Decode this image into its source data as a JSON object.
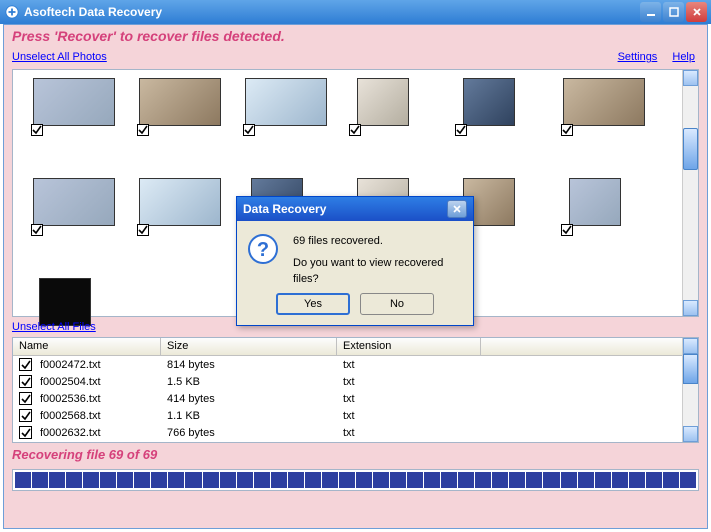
{
  "window": {
    "title": "Asoftech Data Recovery"
  },
  "header": {
    "instruction": "Press 'Recover' to recover files detected."
  },
  "links": {
    "unselect_photos": "Unselect All Photos",
    "unselect_files": "Unselect All Files",
    "settings": "Settings",
    "help": "Help"
  },
  "files_table": {
    "columns": {
      "name": "Name",
      "size": "Size",
      "ext": "Extension"
    },
    "rows": [
      {
        "name": "f0002472.txt",
        "size": "814 bytes",
        "ext": "txt"
      },
      {
        "name": "f0002504.txt",
        "size": "1.5 KB",
        "ext": "txt"
      },
      {
        "name": "f0002536.txt",
        "size": "414 bytes",
        "ext": "txt"
      },
      {
        "name": "f0002568.txt",
        "size": "1.1 KB",
        "ext": "txt"
      },
      {
        "name": "f0002632.txt",
        "size": "766 bytes",
        "ext": "txt"
      }
    ]
  },
  "status": {
    "text": "Recovering file 69 of 69"
  },
  "dialog": {
    "title": "Data Recovery",
    "line1": "69 files recovered.",
    "line2": "Do you want to view recovered files?",
    "yes": "Yes",
    "no": "No"
  }
}
